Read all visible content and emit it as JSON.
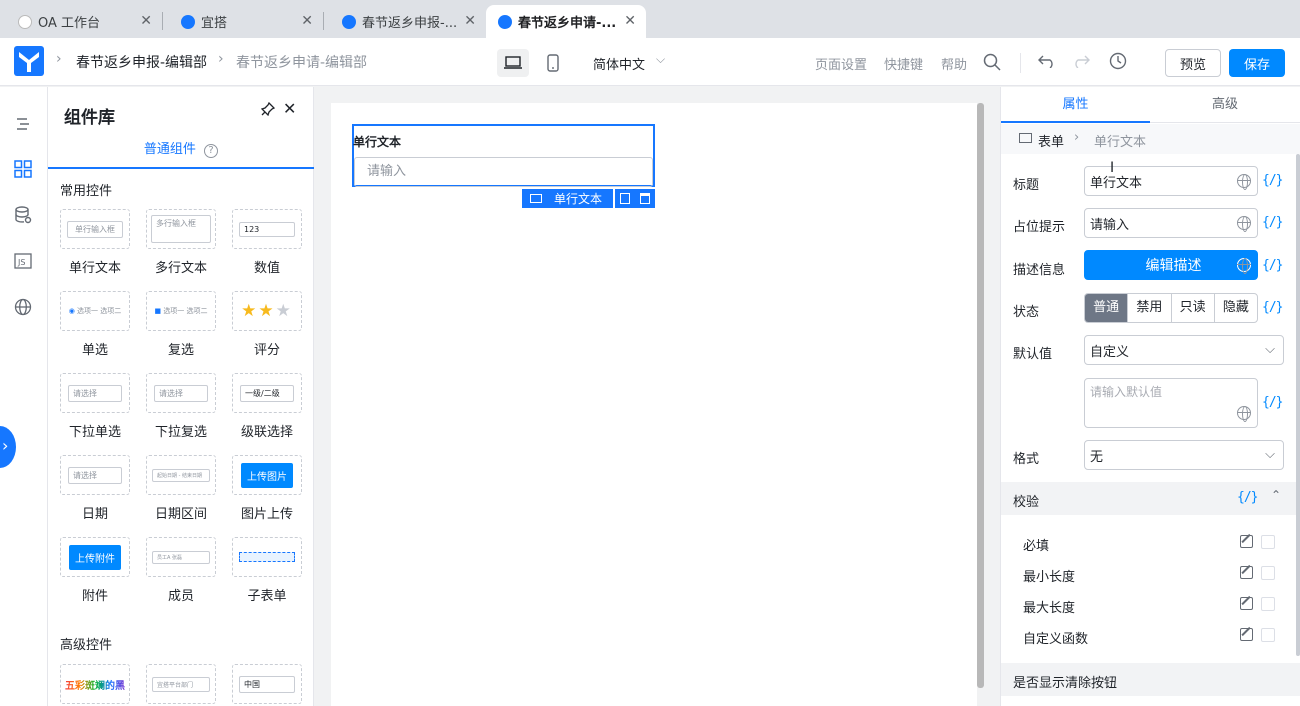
{
  "browser": {
    "tabs": [
      {
        "label": "OA 工作台"
      },
      {
        "label": "宜搭"
      },
      {
        "label": "春节返乡申报-..."
      },
      {
        "label": "春节返乡申请-..."
      }
    ]
  },
  "topbar": {
    "crumb1": "春节返乡申报-编辑部",
    "crumb2": "春节返乡申请-编辑部",
    "language": "简体中文",
    "page_settings": "页面设置",
    "shortcuts": "快捷键",
    "help": "帮助",
    "preview": "预览",
    "save": "保存"
  },
  "library": {
    "title": "组件库",
    "tab": "普通组件",
    "section_common": "常用控件",
    "section_advanced": "高级控件",
    "common": [
      {
        "label": "单行文本",
        "preview": "单行输入框"
      },
      {
        "label": "多行文本",
        "preview": "多行输入框"
      },
      {
        "label": "数值",
        "preview": "123"
      },
      {
        "label": "单选",
        "preview": "选项一  选项二"
      },
      {
        "label": "复选",
        "preview": "选项一  选项二"
      },
      {
        "label": "评分",
        "preview": ""
      },
      {
        "label": "下拉单选",
        "preview": "请选择"
      },
      {
        "label": "下拉复选",
        "preview": "请选择"
      },
      {
        "label": "级联选择",
        "preview": "一级/二级"
      },
      {
        "label": "日期",
        "preview": "请选择"
      },
      {
        "label": "日期区间",
        "preview": "起始日期 - 结束日期"
      },
      {
        "label": "图片上传",
        "preview": "上传图片"
      },
      {
        "label": "附件",
        "preview": "上传附件"
      },
      {
        "label": "成员",
        "preview": "员工A  张磊"
      },
      {
        "label": "子表单",
        "preview": ""
      }
    ],
    "advanced": [
      {
        "preview": "五彩斑斓的黑"
      },
      {
        "preview": "宜搭平台部门"
      },
      {
        "preview": "中国"
      }
    ]
  },
  "canvas": {
    "field_label": "单行文本",
    "field_placeholder": "请输入",
    "toolbar_label": "单行文本"
  },
  "props": {
    "tab_attr": "属性",
    "tab_adv": "高级",
    "crumb_form": "表单",
    "crumb_field": "单行文本",
    "title_label": "标题",
    "title_value": "单行文本",
    "placeholder_label": "占位提示",
    "placeholder_value": "请输入",
    "desc_label": "描述信息",
    "desc_button": "编辑描述",
    "state_label": "状态",
    "states": [
      "普通",
      "禁用",
      "只读",
      "隐藏"
    ],
    "default_label": "默认值",
    "default_select": "自定义",
    "default_input_placeholder": "请输入默认值",
    "format_label": "格式",
    "format_value": "无",
    "validation_title": "校验",
    "validations": [
      "必填",
      "最小长度",
      "最大长度",
      "自定义函数"
    ],
    "clear_btn_title": "是否显示清除按钮",
    "fx": "{/}"
  },
  "colors": {
    "primary": "#0089ff",
    "selected_border": "#1677ff"
  }
}
